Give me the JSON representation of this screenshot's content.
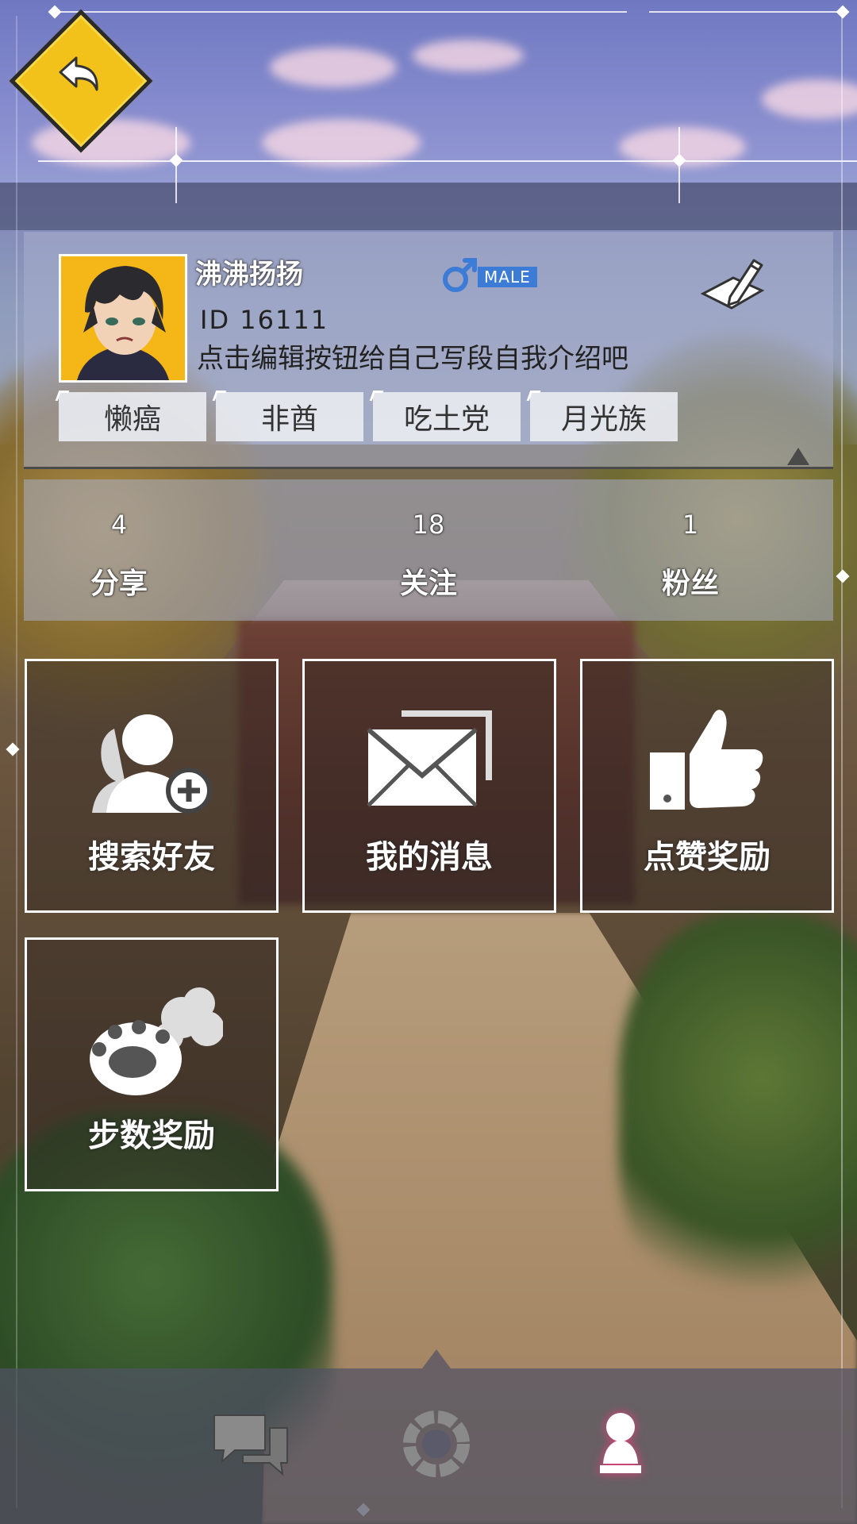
{
  "header": {
    "back_label": ""
  },
  "profile": {
    "nickname": "沸沸扬扬",
    "gender_label": "MALE",
    "user_id": "ID 16111",
    "bio": "点击编辑按钮给自己写段自我介绍吧",
    "tags": [
      "懒癌",
      "非酋",
      "吃土党",
      "月光族"
    ]
  },
  "stats": [
    {
      "value": "4",
      "label": "分享"
    },
    {
      "value": "18",
      "label": "关注"
    },
    {
      "value": "1",
      "label": "粉丝"
    }
  ],
  "tiles": [
    {
      "label": "搜索好友",
      "icon": "add-friend-icon"
    },
    {
      "label": "我的消息",
      "icon": "mail-icon"
    },
    {
      "label": "点赞奖励",
      "icon": "thumbs-up-icon"
    },
    {
      "label": "步数奖励",
      "icon": "paw-icon"
    }
  ],
  "nav": {
    "items": [
      {
        "name": "chat",
        "icon": "chat-bubbles-icon",
        "active": false
      },
      {
        "name": "hub",
        "icon": "ring-icon",
        "active": false
      },
      {
        "name": "profile",
        "icon": "user-icon",
        "active": true
      }
    ]
  },
  "colors": {
    "accent_yellow": "#f2c21a",
    "male_blue": "#3c7bd6",
    "active_pink": "#e0407a"
  }
}
